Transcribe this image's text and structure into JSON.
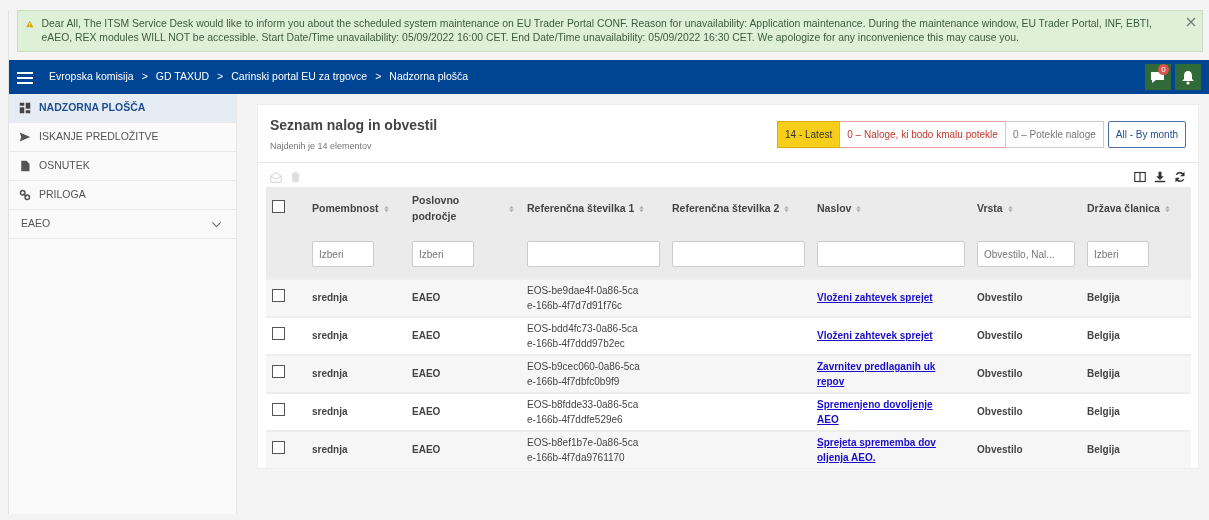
{
  "notice": {
    "text": "Dear All, The ITSM Service Desk would like to inform you about the scheduled system maintenance on EU Trader Portal CONF. Reason for unavailability: Application maintenance. During the maintenance window, EU Trader Portal, INF, EBTI, eAEO, REX modules WILL NOT be accessible. Start Date/Time unavailability: 05/09/2022 16:00 CET. End Date/Time unavailability: 05/09/2022 16:30 CET. We apologize for any inconvenience this may cause you."
  },
  "breadcrumb": {
    "separator": ">",
    "items": [
      "Evropska komisija",
      "GD TAXUD",
      "Carinski portal EU za trgovce",
      "Nadzorna plošča"
    ]
  },
  "notifications": {
    "count": "0"
  },
  "sidebar": {
    "items": [
      {
        "label": "NADZORNA PLOŠČA",
        "kind": "dashboard",
        "selected": true
      },
      {
        "label": "ISKANJE PREDLOŽITVE",
        "kind": "send",
        "selected": false
      },
      {
        "label": "OSNUTEK",
        "kind": "file",
        "selected": false
      },
      {
        "label": "PRILOGA",
        "kind": "link",
        "selected": false
      },
      {
        "label": "EAEO",
        "kind": "group",
        "selected": false,
        "expanded": false
      }
    ]
  },
  "panel": {
    "title": "Seznam nalog in obvestil",
    "subtitle": "Najdenih je 14 elementov",
    "filters": [
      {
        "label": "14 - Latest",
        "kind": "latest"
      },
      {
        "label": "0 – Naloge, ki bodo kmalu potekle",
        "kind": "expiring"
      },
      {
        "label": "0 – Potekle naloge",
        "kind": "expired"
      },
      {
        "label": "All - By month",
        "kind": "month"
      }
    ]
  },
  "table": {
    "select_all_checked": false,
    "columns": [
      {
        "label": "Pomembnost",
        "filter": {
          "kind": "select",
          "placeholder": "Izberi"
        }
      },
      {
        "label": "Poslovno področje",
        "filter": {
          "kind": "select",
          "placeholder": "Izberi"
        }
      },
      {
        "label": "Referenčna številka 1",
        "filter": {
          "kind": "text"
        }
      },
      {
        "label": "Referenčna številka 2",
        "filter": {
          "kind": "text"
        }
      },
      {
        "label": "Naslov",
        "filter": {
          "kind": "text"
        }
      },
      {
        "label": "Vrsta",
        "filter": {
          "kind": "select",
          "placeholder": "Obvestilo, Nal..."
        }
      },
      {
        "label": "Država članica",
        "filter": {
          "kind": "select",
          "placeholder": "Izberi"
        }
      }
    ],
    "rows": [
      {
        "checked": false,
        "cells": [
          "srednja",
          "EAEO",
          "EOS-be9dae4f-0a86-5cae-166b-4f7d7d91f76c",
          "",
          "Vloženi zahtevek sprejet",
          "Obvestilo",
          "Belgija"
        ]
      },
      {
        "checked": false,
        "cells": [
          "srednja",
          "EAEO",
          "EOS-bdd4fc73-0a86-5cae-166b-4f7ddd97b2ec",
          "",
          "Vloženi zahtevek sprejet",
          "Obvestilo",
          "Belgija"
        ]
      },
      {
        "checked": false,
        "cells": [
          "srednja",
          "EAEO",
          "EOS-b9cec060-0a86-5cae-166b-4f7dbfc0b9f9",
          "",
          "Zavrnitev predlaganih ukrepov",
          "Obvestilo",
          "Belgija"
        ]
      },
      {
        "checked": false,
        "cells": [
          "srednja",
          "EAEO",
          "EOS-b8fdde33-0a86-5cae-166b-4f7ddfe529e6",
          "",
          "Spremenjeno dovoljenje AEO",
          "Obvestilo",
          "Belgija"
        ]
      },
      {
        "checked": false,
        "cells": [
          "srednja",
          "EAEO",
          "EOS-b8ef1b7e-0a86-5cae-166b-4f7da9761170",
          "",
          "Sprejeta sprememba dovoljenja AEO.",
          "Obvestilo",
          "Belgija"
        ]
      }
    ]
  }
}
